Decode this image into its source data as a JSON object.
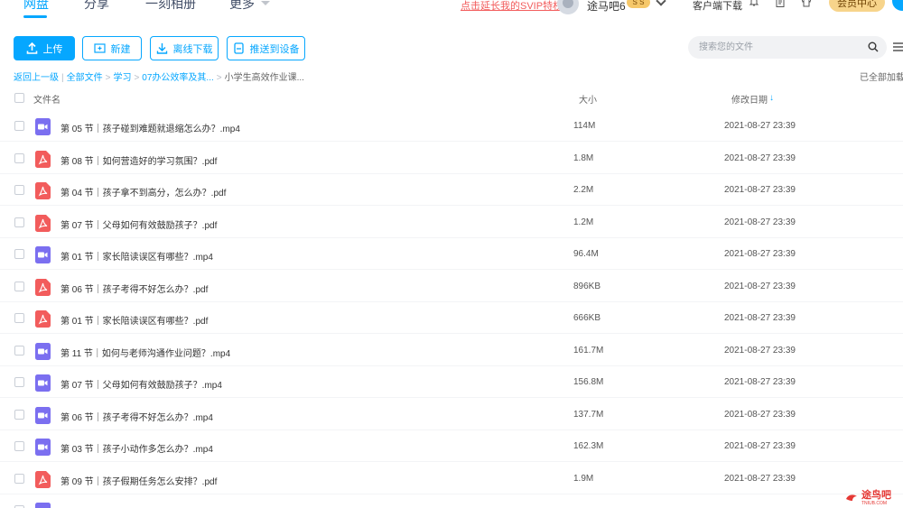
{
  "nav": {
    "tabs": [
      {
        "label": "网盘"
      },
      {
        "label": "分享"
      },
      {
        "label": "一刻相册"
      },
      {
        "label": "更多"
      }
    ],
    "promo": "点击延长我的SVIP特权",
    "username": "途马吧6",
    "vip_badge": "S S",
    "client_download": "客户端下载",
    "member_center": "会员中心"
  },
  "toolbar": {
    "upload": "上传",
    "new_folder": "新建",
    "offline_download": "离线下载",
    "push_device": "推送到设备"
  },
  "search": {
    "placeholder": "搜索您的文件"
  },
  "breadcrumb": {
    "back": "返回上一级",
    "all_files": "全部文件",
    "items": [
      "学习",
      "07办公效率及其...",
      "小学生高效作业课..."
    ]
  },
  "loaded_status": "已全部加载",
  "table": {
    "col_name": "文件名",
    "col_size": "大小",
    "col_date": "修改日期",
    "sort_arrow": "↓",
    "rows": [
      {
        "name": "第 05 节｜孩子碰到难题就退缩怎么办？.mp4",
        "type": "video",
        "size": "114M",
        "date": "2021-08-27 23:39"
      },
      {
        "name": "第 08 节｜如何营造好的学习氛围？.pdf",
        "type": "pdf",
        "size": "1.8M",
        "date": "2021-08-27 23:39"
      },
      {
        "name": "第 04 节｜孩子拿不到高分，怎么办？.pdf",
        "type": "pdf",
        "size": "2.2M",
        "date": "2021-08-27 23:39"
      },
      {
        "name": "第 07 节｜父母如何有效鼓励孩子？.pdf",
        "type": "pdf",
        "size": "1.2M",
        "date": "2021-08-27 23:39"
      },
      {
        "name": "第 01 节｜家长陪读误区有哪些？.mp4",
        "type": "video",
        "size": "96.4M",
        "date": "2021-08-27 23:39"
      },
      {
        "name": "第 06 节｜孩子考得不好怎么办？.pdf",
        "type": "pdf",
        "size": "896KB",
        "date": "2021-08-27 23:39"
      },
      {
        "name": "第 01 节｜家长陪读误区有哪些？.pdf",
        "type": "pdf",
        "size": "666KB",
        "date": "2021-08-27 23:39"
      },
      {
        "name": "第 11 节｜如何与老师沟通作业问题？.mp4",
        "type": "video",
        "size": "161.7M",
        "date": "2021-08-27 23:39"
      },
      {
        "name": "第 07 节｜父母如何有效鼓励孩子？.mp4",
        "type": "video",
        "size": "156.8M",
        "date": "2021-08-27 23:39"
      },
      {
        "name": "第 06 节｜孩子考得不好怎么办？.mp4",
        "type": "video",
        "size": "137.7M",
        "date": "2021-08-27 23:39"
      },
      {
        "name": "第 03 节｜孩子小动作多怎么办？.mp4",
        "type": "video",
        "size": "162.3M",
        "date": "2021-08-27 23:39"
      },
      {
        "name": "第 09 节｜孩子假期任务怎么安排？.pdf",
        "type": "pdf",
        "size": "1.9M",
        "date": "2021-08-27 23:39"
      },
      {
        "name": "",
        "type": "video",
        "size": "",
        "date": ""
      }
    ]
  },
  "watermark": {
    "text": "途鸟吧",
    "sub": "TNIUB.COM"
  },
  "colors": {
    "accent": "#06a7ff",
    "video_icon": "#7b6ff0",
    "pdf_icon": "#f25c5c",
    "promo": "#f25c5c"
  }
}
